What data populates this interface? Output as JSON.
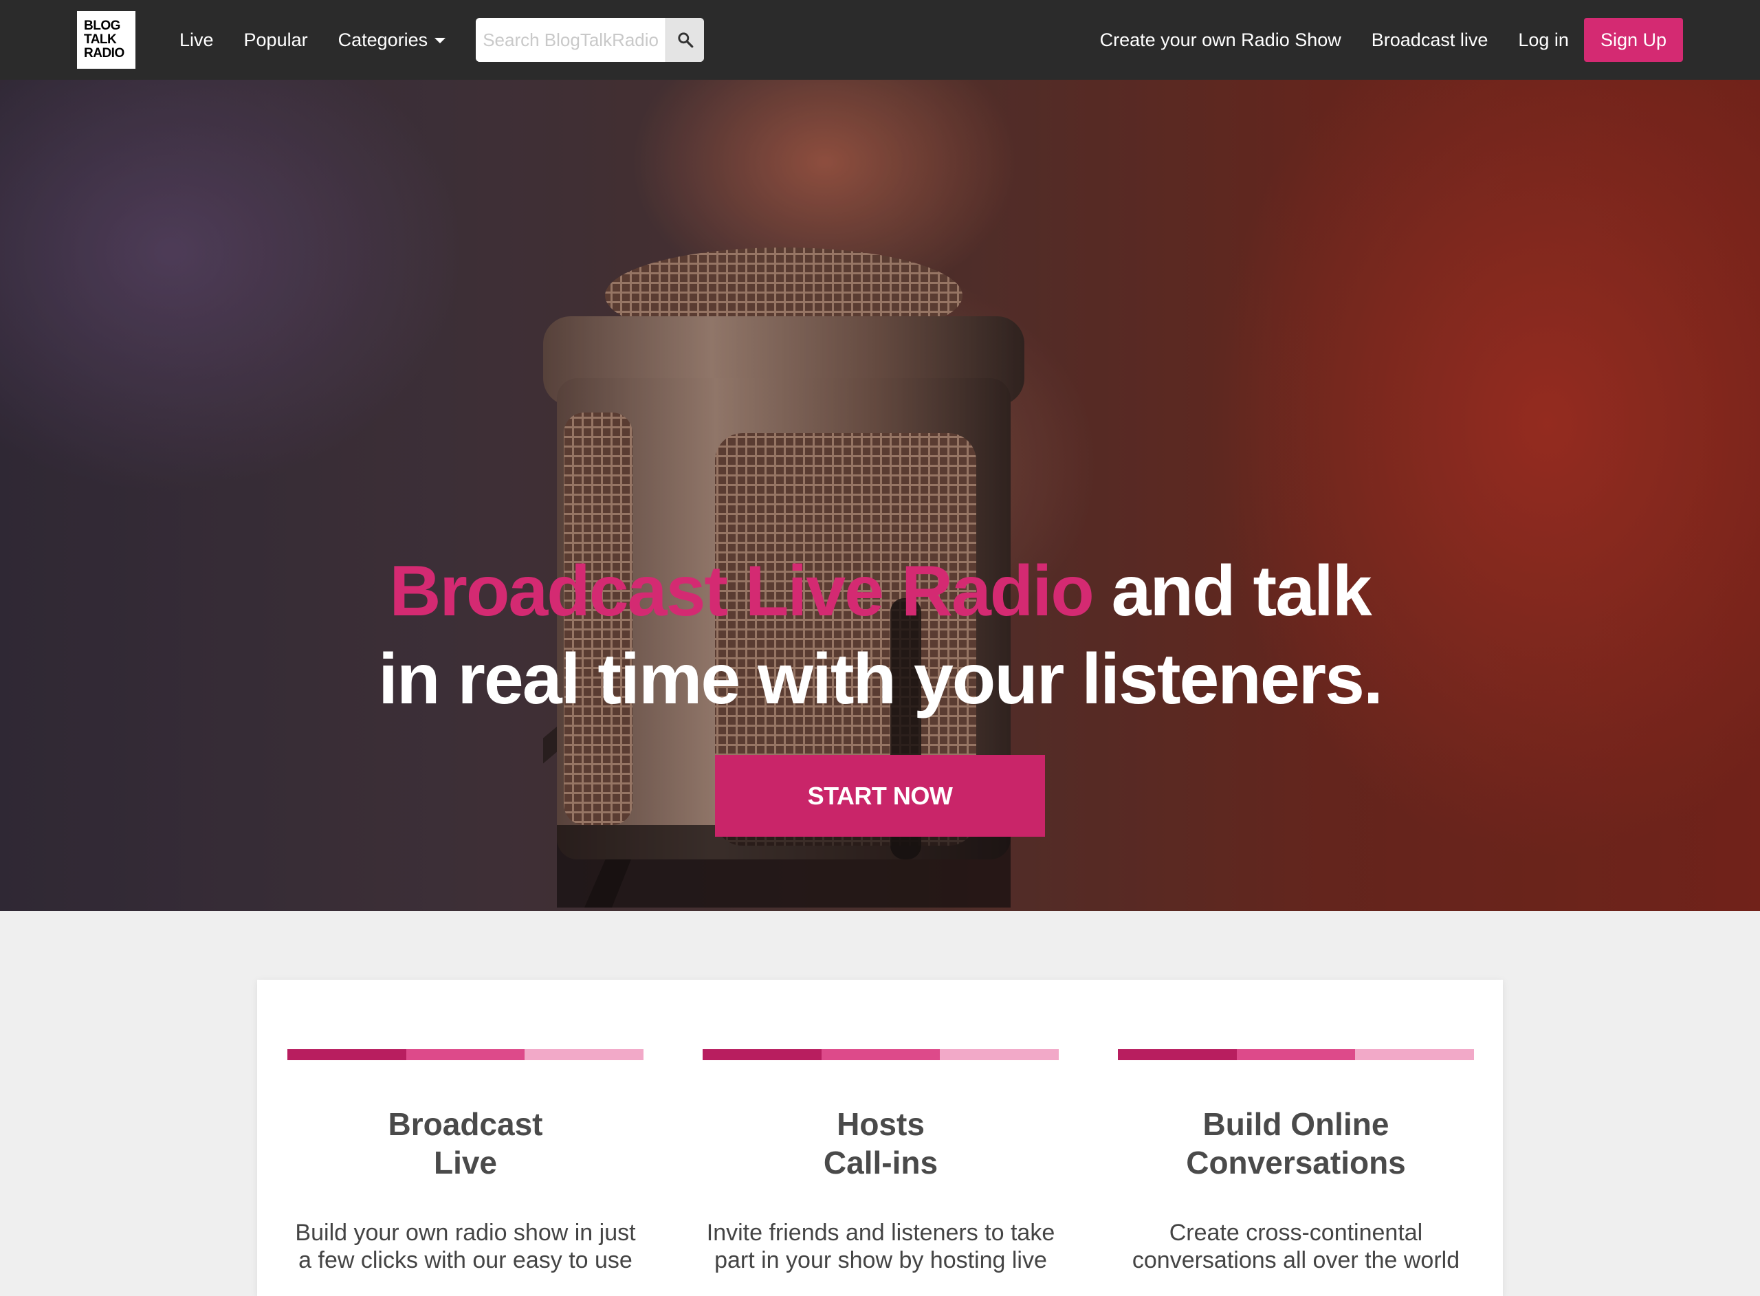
{
  "navbar": {
    "logo": {
      "line1": "BLOG",
      "line2": "TALK",
      "line3": "RADIO"
    },
    "links": [
      {
        "label": "Live"
      },
      {
        "label": "Popular"
      },
      {
        "label": "Categories"
      }
    ],
    "search": {
      "placeholder": "Search BlogTalkRadio",
      "icon": "search-icon"
    },
    "right_links": [
      {
        "label": "Create your own Radio Show"
      },
      {
        "label": "Broadcast live"
      },
      {
        "label": "Log in"
      }
    ],
    "signup_label": "Sign Up"
  },
  "hero": {
    "headline_highlight": "Broadcast Live Radio",
    "headline_rest_line1": "and talk",
    "headline_line2": "in real time with your listeners.",
    "cta_label": "START NOW"
  },
  "features": [
    {
      "title_line1": "Broadcast",
      "title_line2": "Live",
      "desc_line1": "Build your own radio show in just",
      "desc_line2": "a few clicks with our easy to use"
    },
    {
      "title_line1": "Hosts",
      "title_line2": "Call-ins",
      "desc_line1": "Invite friends and listeners to take",
      "desc_line2": "part in your show by hosting live"
    },
    {
      "title_line1": "Build Online",
      "title_line2": "Conversations",
      "desc_line1": "Create cross-continental",
      "desc_line2": "conversations all over the world"
    }
  ],
  "colors": {
    "navbar_bg": "#2b2b2b",
    "accent": "#d42a72",
    "cta": "#c92569",
    "bar_dark": "#b81e5f",
    "bar_mid": "#dd4a8a",
    "bar_light": "#f2a9c8",
    "page_bg": "#efefef"
  }
}
